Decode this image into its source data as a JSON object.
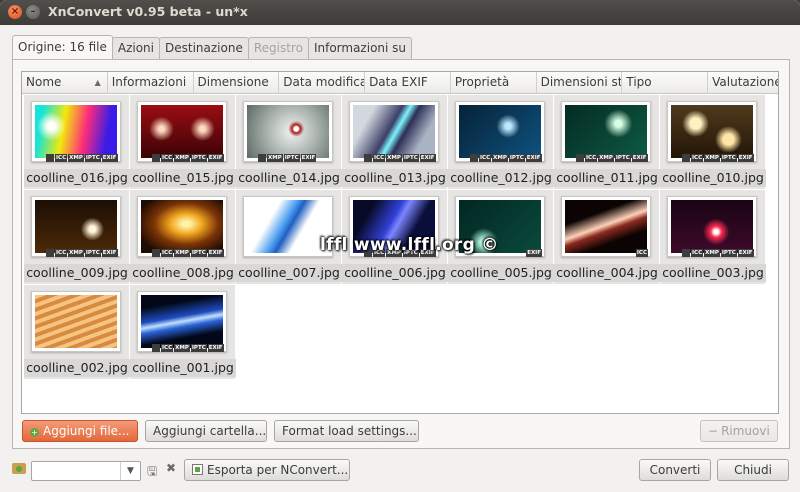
{
  "window": {
    "title": "XnConvert v0.95 beta - un*x"
  },
  "tabs": [
    {
      "label": "Origine: 16 file",
      "active": true,
      "disabled": false
    },
    {
      "label": "Azioni",
      "active": false,
      "disabled": false
    },
    {
      "label": "Destinazione",
      "active": false,
      "disabled": false
    },
    {
      "label": "Registro",
      "active": false,
      "disabled": true
    },
    {
      "label": "Informazioni su",
      "active": false,
      "disabled": false
    }
  ],
  "columns": [
    "Nome",
    "Informazioni",
    "Dimensione",
    "Data modifica",
    "Data EXIF",
    "Proprietà",
    "Dimensioni st",
    "Tipo",
    "Valutazione"
  ],
  "files": [
    {
      "name": "coolline_016.jpg",
      "badges": [
        "ICC",
        "XMP",
        "IPTC",
        "EXIF"
      ]
    },
    {
      "name": "coolline_015.jpg",
      "badges": [
        "ICC",
        "XMP",
        "IPTC",
        "EXIF"
      ]
    },
    {
      "name": "coolline_014.jpg",
      "badges": [
        "XMP",
        "IPTC",
        "EXIF"
      ]
    },
    {
      "name": "coolline_013.jpg",
      "badges": [
        "ICC",
        "XMP",
        "IPTC",
        "EXIF"
      ]
    },
    {
      "name": "coolline_012.jpg",
      "badges": [
        "ICC",
        "XMP",
        "IPTC",
        "EXIF"
      ]
    },
    {
      "name": "coolline_011.jpg",
      "badges": [
        "ICC",
        "XMP",
        "IPTC",
        "EXIF"
      ]
    },
    {
      "name": "coolline_010.jpg",
      "badges": [
        "ICC",
        "XMP",
        "IPTC",
        "EXIF"
      ]
    },
    {
      "name": "coolline_009.jpg",
      "badges": [
        "ICC",
        "XMP",
        "IPTC",
        "EXIF"
      ]
    },
    {
      "name": "coolline_008.jpg",
      "badges": [
        "ICC",
        "XMP",
        "IPTC",
        "EXIF"
      ]
    },
    {
      "name": "coolline_007.jpg",
      "badges": []
    },
    {
      "name": "coolline_006.jpg",
      "badges": [
        "ICC",
        "XMP",
        "IPTC",
        "EXIF"
      ]
    },
    {
      "name": "coolline_005.jpg",
      "badges": [
        "EXIF"
      ]
    },
    {
      "name": "coolline_004.jpg",
      "badges": [
        "ICC"
      ]
    },
    {
      "name": "coolline_003.jpg",
      "badges": [
        "ICC",
        "XMP",
        "IPTC",
        "EXIF"
      ]
    },
    {
      "name": "coolline_002.jpg",
      "badges": []
    },
    {
      "name": "coolline_001.jpg",
      "badges": [
        "ICC",
        "XMP",
        "IPTC",
        "EXIF"
      ]
    }
  ],
  "watermark": "lffl www.lffl.org ©",
  "buttons": {
    "add_files": "Aggiungi file...",
    "add_folder": "Aggiungi cartella...",
    "format_load": "Format load settings...",
    "remove": "Rimuovi",
    "export": "Esporta per NConvert...",
    "convert": "Converti",
    "close": "Chiudi"
  },
  "preset_combo": {
    "value": ""
  },
  "colors": {
    "accent": "#e3693b",
    "titlebar": "#3c3b37"
  }
}
